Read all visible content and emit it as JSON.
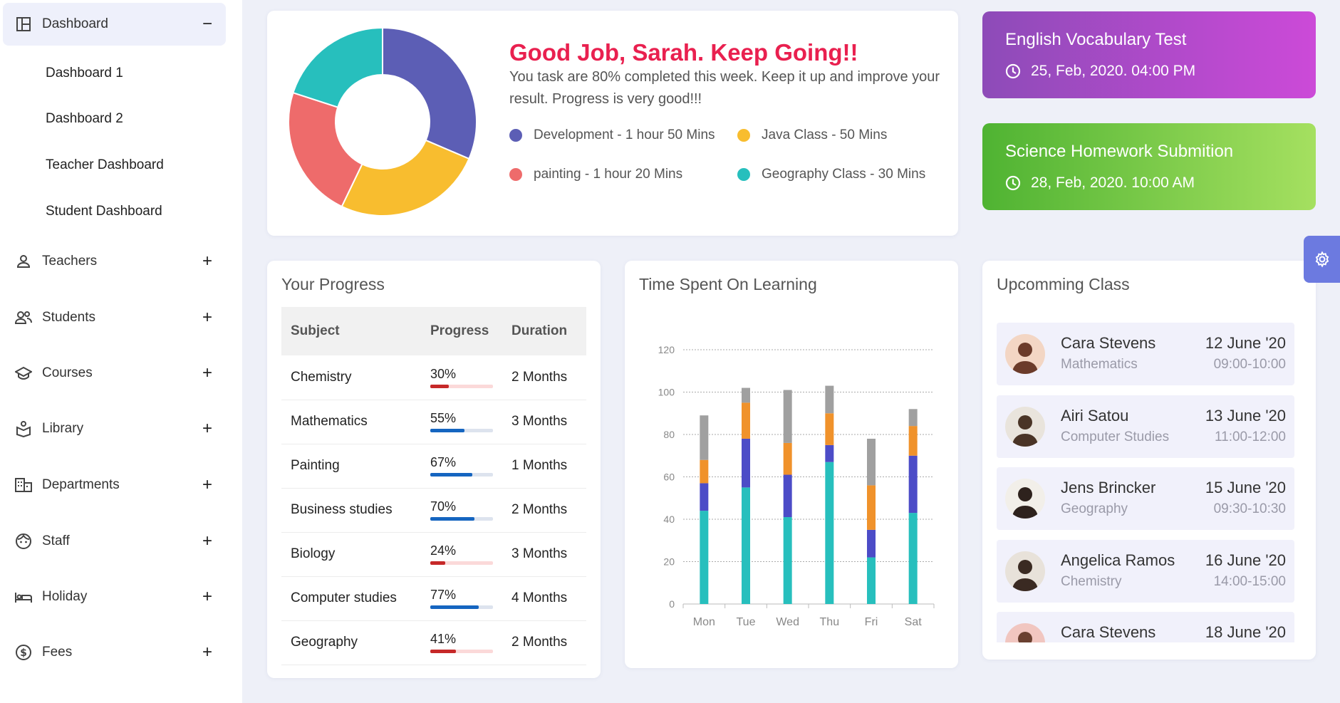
{
  "sidebar": {
    "dashboard": {
      "label": "Dashboard",
      "toggle": "−"
    },
    "sub_items": [
      "Dashboard 1",
      "Dashboard 2",
      "Teacher Dashboard",
      "Student Dashboard"
    ],
    "items": [
      {
        "label": "Teachers",
        "icon": "person-icon",
        "toggle": "+"
      },
      {
        "label": "Students",
        "icon": "people-icon",
        "toggle": "+"
      },
      {
        "label": "Courses",
        "icon": "graduation-cap-icon",
        "toggle": "+"
      },
      {
        "label": "Library",
        "icon": "book-icon",
        "toggle": "+"
      },
      {
        "label": "Departments",
        "icon": "building-icon",
        "toggle": "+"
      },
      {
        "label": "Staff",
        "icon": "face-icon",
        "toggle": "+"
      },
      {
        "label": "Holiday",
        "icon": "bed-icon",
        "toggle": "+"
      },
      {
        "label": "Fees",
        "icon": "dollar-icon",
        "toggle": "+"
      }
    ]
  },
  "hero": {
    "title": "Good Job, Sarah. Keep Going!!",
    "text": "You task are 80% completed this week. Keep it up and improve your result. Progress is very good!!!",
    "legend": [
      {
        "label": "Development - 1 hour 50 Mins",
        "color": "#5c5eb5"
      },
      {
        "label": "Java Class - 50 Mins",
        "color": "#f8bd2f"
      },
      {
        "label": "painting - 1 hour 20 Mins",
        "color": "#ee6b6b"
      },
      {
        "label": "Geography Class - 30 Mins",
        "color": "#27bfbd"
      }
    ],
    "donut": {
      "segments": [
        {
          "name": "Development",
          "value": 110,
          "color": "#5c5eb5"
        },
        {
          "name": "Java Class",
          "value": 90,
          "color": "#f8bd2f"
        },
        {
          "name": "painting",
          "value": 80,
          "color": "#ee6b6b"
        },
        {
          "name": "Geography Class",
          "value": 70,
          "color": "#27bfbd"
        }
      ]
    }
  },
  "events": [
    {
      "title": "English Vocabulary Test",
      "date": "25, Feb, 2020. 04:00 PM",
      "icon": "clock-icon"
    },
    {
      "title": "Science Homework Submition",
      "date": "28, Feb, 2020. 10:00 AM",
      "icon": "clock-icon"
    }
  ],
  "progress": {
    "title": "Your Progress",
    "headers": [
      "Subject",
      "Progress",
      "Duration"
    ],
    "rows": [
      {
        "subject": "Chemistry",
        "progress": "30%",
        "pct": 30,
        "color": "#c62828",
        "track": "#fbd9d9",
        "duration": "2 Months"
      },
      {
        "subject": "Mathematics",
        "progress": "55%",
        "pct": 55,
        "color": "#1565c0",
        "track": "#dde3ee",
        "duration": "3 Months"
      },
      {
        "subject": "Painting",
        "progress": "67%",
        "pct": 67,
        "color": "#1565c0",
        "track": "#dde3ee",
        "duration": "1 Months"
      },
      {
        "subject": "Business studies",
        "progress": "70%",
        "pct": 70,
        "color": "#1565c0",
        "track": "#dde3ee",
        "duration": "2 Months"
      },
      {
        "subject": "Biology",
        "progress": "24%",
        "pct": 24,
        "color": "#c62828",
        "track": "#fbd9d9",
        "duration": "3 Months"
      },
      {
        "subject": "Computer studies",
        "progress": "77%",
        "pct": 77,
        "color": "#1565c0",
        "track": "#dde3ee",
        "duration": "4 Months"
      },
      {
        "subject": "Geography",
        "progress": "41%",
        "pct": 41,
        "color": "#c62828",
        "track": "#fbd9d9",
        "duration": "2 Months"
      }
    ]
  },
  "time_chart": {
    "title": "Time Spent On Learning"
  },
  "chart_data": {
    "type": "bar",
    "stacked": true,
    "categories": [
      "Mon",
      "Tue",
      "Wed",
      "Thu",
      "Fri",
      "Sat"
    ],
    "ylim": [
      0,
      120
    ],
    "yticks": [
      0,
      20,
      40,
      60,
      80,
      100,
      120
    ],
    "grid": true,
    "series": [
      {
        "values": [
          44,
          55,
          41,
          67,
          22,
          43
        ],
        "color": "#27bfbd"
      },
      {
        "values": [
          13,
          23,
          20,
          8,
          13,
          27
        ],
        "color": "#4c4cc7"
      },
      {
        "values": [
          11,
          17,
          15,
          15,
          21,
          14
        ],
        "color": "#f0922b"
      },
      {
        "values": [
          21,
          7,
          25,
          13,
          22,
          8
        ],
        "color": "#a0a0a0"
      }
    ]
  },
  "upcoming": {
    "title": "Upcomming Class",
    "items": [
      {
        "name": "Cara Stevens",
        "subject": "Mathematics",
        "date": "12 June '20",
        "time": "09:00-10:00"
      },
      {
        "name": "Airi Satou",
        "subject": "Computer Studies",
        "date": "13 June '20",
        "time": "11:00-12:00"
      },
      {
        "name": "Jens Brincker",
        "subject": "Geography",
        "date": "15 June '20",
        "time": "09:30-10:30"
      },
      {
        "name": "Angelica Ramos",
        "subject": "Chemistry",
        "date": "16 June '20",
        "time": "14:00-15:00"
      },
      {
        "name": "Cara Stevens",
        "subject": "",
        "date": "18 June '20",
        "time": ""
      }
    ]
  },
  "settings": {
    "icon": "gear-icon"
  }
}
